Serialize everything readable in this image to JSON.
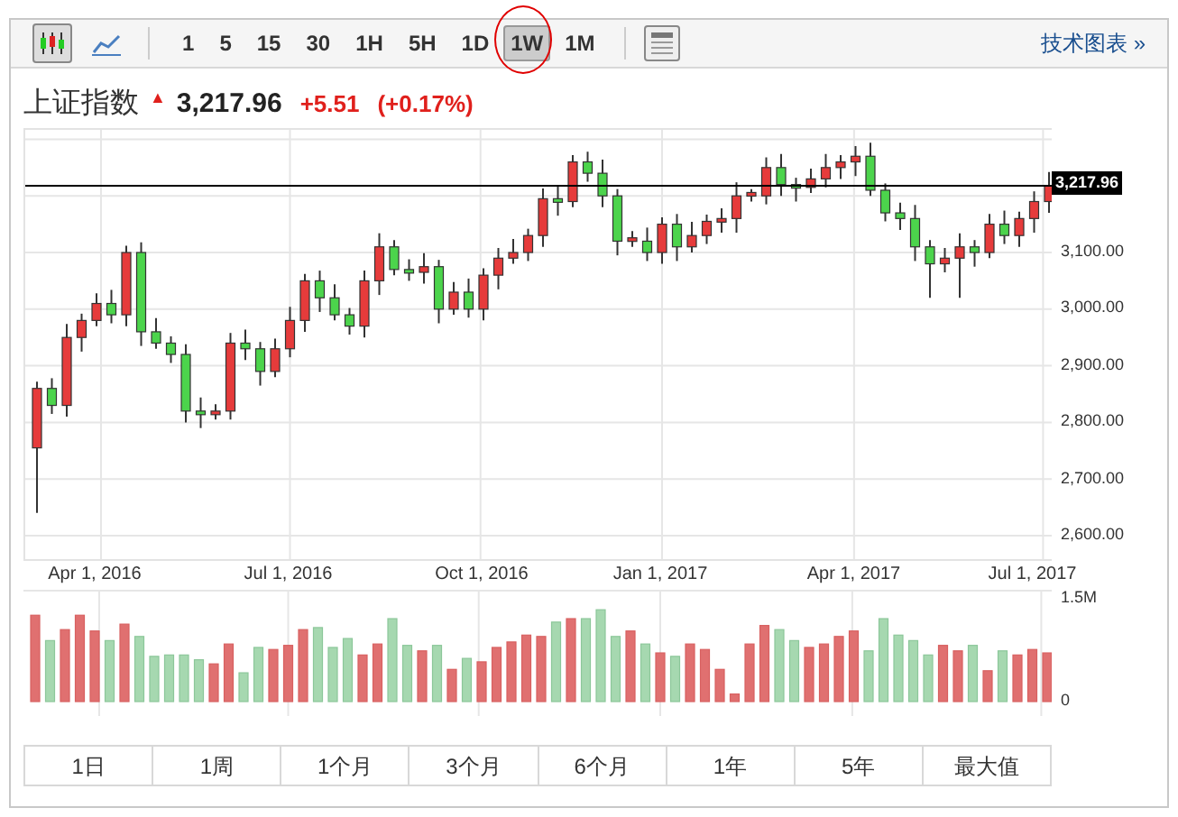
{
  "toolbar": {
    "chart_types": [
      {
        "kind": "candles",
        "selected": true
      },
      {
        "kind": "line",
        "selected": false
      }
    ],
    "intervals": [
      {
        "label": "1",
        "selected": false,
        "circled": false
      },
      {
        "label": "5",
        "selected": false,
        "circled": false
      },
      {
        "label": "15",
        "selected": false,
        "circled": false
      },
      {
        "label": "30",
        "selected": false,
        "circled": false
      },
      {
        "label": "1H",
        "selected": false,
        "circled": false
      },
      {
        "label": "5H",
        "selected": false,
        "circled": false
      },
      {
        "label": "1D",
        "selected": false,
        "circled": false
      },
      {
        "label": "1W",
        "selected": true,
        "circled": true
      },
      {
        "label": "1M",
        "selected": false,
        "circled": false
      }
    ],
    "link": "技术图表 »"
  },
  "quote": {
    "name": "上证指数",
    "arrow": "▲",
    "price": "3,217.96",
    "change": "+5.51",
    "change_percent": "(+0.17%)"
  },
  "price_chart": {
    "chart_data": {
      "type": "candlestick",
      "categories": [
        null,
        null,
        null,
        null,
        "Apr 1, 2016",
        null,
        null,
        null,
        null,
        null,
        null,
        null,
        null,
        null,
        null,
        null,
        null,
        "Jul 1, 2016",
        null,
        null,
        null,
        null,
        null,
        null,
        null,
        null,
        null,
        null,
        null,
        null,
        "Oct 1, 2016",
        null,
        null,
        null,
        null,
        null,
        null,
        null,
        null,
        null,
        null,
        null,
        "Jan 1, 2017",
        null,
        null,
        null,
        null,
        null,
        null,
        null,
        null,
        null,
        null,
        null,
        null,
        "Apr 1, 2017",
        null,
        null,
        null,
        null,
        null,
        null,
        null,
        null,
        null,
        null,
        null,
        "Jul 1, 2017",
        null
      ],
      "ohlc": [
        [
          2755,
          2872,
          2640,
          2860
        ],
        [
          2860,
          2878,
          2815,
          2830
        ],
        [
          2830,
          2974,
          2810,
          2950
        ],
        [
          2950,
          2992,
          2925,
          2980
        ],
        [
          2980,
          3028,
          2970,
          3010
        ],
        [
          3010,
          3034,
          2975,
          2990
        ],
        [
          2990,
          3112,
          2970,
          3100
        ],
        [
          3100,
          3118,
          2935,
          2960
        ],
        [
          2960,
          2984,
          2930,
          2940
        ],
        [
          2940,
          2952,
          2905,
          2920
        ],
        [
          2920,
          2938,
          2800,
          2820
        ],
        [
          2820,
          2844,
          2790,
          2815
        ],
        [
          2815,
          2832,
          2805,
          2820
        ],
        [
          2820,
          2958,
          2805,
          2940
        ],
        [
          2940,
          2964,
          2910,
          2930
        ],
        [
          2930,
          2942,
          2865,
          2890
        ],
        [
          2890,
          2948,
          2880,
          2930
        ],
        [
          2930,
          3004,
          2915,
          2980
        ],
        [
          2980,
          3062,
          2960,
          3050
        ],
        [
          3050,
          3068,
          2995,
          3020
        ],
        [
          3020,
          3044,
          2980,
          2990
        ],
        [
          2990,
          3002,
          2955,
          2970
        ],
        [
          2970,
          3068,
          2950,
          3050
        ],
        [
          3050,
          3134,
          3025,
          3110
        ],
        [
          3110,
          3122,
          3060,
          3070
        ],
        [
          3070,
          3088,
          3050,
          3065
        ],
        [
          3065,
          3099,
          3045,
          3075
        ],
        [
          3075,
          3087,
          2975,
          3000
        ],
        [
          3000,
          3048,
          2990,
          3030
        ],
        [
          3030,
          3054,
          2985,
          3000
        ],
        [
          3000,
          3072,
          2980,
          3060
        ],
        [
          3060,
          3108,
          3035,
          3090
        ],
        [
          3090,
          3124,
          3080,
          3100
        ],
        [
          3100,
          3142,
          3085,
          3130
        ],
        [
          3130,
          3213,
          3110,
          3195
        ],
        [
          3195,
          3219,
          3165,
          3190
        ],
        [
          3190,
          3272,
          3180,
          3260
        ],
        [
          3260,
          3278,
          3225,
          3240
        ],
        [
          3240,
          3264,
          3180,
          3200
        ],
        [
          3200,
          3212,
          3095,
          3120
        ],
        [
          3120,
          3138,
          3110,
          3126
        ],
        [
          3120,
          3144,
          3085,
          3100
        ],
        [
          3100,
          3162,
          3080,
          3150
        ],
        [
          3150,
          3168,
          3085,
          3110
        ],
        [
          3110,
          3154,
          3100,
          3130
        ],
        [
          3130,
          3167,
          3115,
          3155
        ],
        [
          3155,
          3178,
          3135,
          3160
        ],
        [
          3160,
          3224,
          3135,
          3200
        ],
        [
          3200,
          3212,
          3190,
          3206
        ],
        [
          3200,
          3268,
          3185,
          3250
        ],
        [
          3250,
          3274,
          3200,
          3220
        ],
        [
          3220,
          3232,
          3190,
          3215
        ],
        [
          3215,
          3248,
          3205,
          3230
        ],
        [
          3230,
          3274,
          3215,
          3250
        ],
        [
          3250,
          3272,
          3230,
          3260
        ],
        [
          3260,
          3288,
          3235,
          3270
        ],
        [
          3270,
          3294,
          3200,
          3210
        ],
        [
          3210,
          3222,
          3155,
          3170
        ],
        [
          3170,
          3188,
          3140,
          3160
        ],
        [
          3160,
          3184,
          3085,
          3110
        ],
        [
          3110,
          3122,
          3020,
          3080
        ],
        [
          3080,
          3108,
          3065,
          3090
        ],
        [
          3090,
          3134,
          3020,
          3110
        ],
        [
          3110,
          3122,
          3075,
          3100
        ],
        [
          3100,
          3168,
          3090,
          3150
        ],
        [
          3150,
          3174,
          3115,
          3130
        ],
        [
          3130,
          3172,
          3110,
          3160
        ],
        [
          3160,
          3208,
          3135,
          3190
        ],
        [
          3190,
          3242,
          3170,
          3218
        ]
      ],
      "grid": true,
      "ylim": [
        2552.2,
        3316.6
      ],
      "yticks": [
        {
          "value": 3100,
          "label": "3,100.00"
        },
        {
          "value": 3000,
          "label": "3,000.00"
        },
        {
          "value": 2900,
          "label": "2,900.00"
        },
        {
          "value": 2800,
          "label": "2,800.00"
        },
        {
          "value": 2700,
          "label": "2,700.00"
        },
        {
          "value": 2600,
          "label": "2,600.00"
        }
      ],
      "ref_lines": [
        {
          "axis": "y",
          "value": 3217.96,
          "label": "3,217.96"
        }
      ]
    }
  },
  "volume_chart": {
    "chart_data": {
      "type": "bar",
      "grid": true,
      "values": [
        1.26,
        0.89,
        1.05,
        1.26,
        1.03,
        0.89,
        1.13,
        0.95,
        0.66,
        0.68,
        0.68,
        0.61,
        0.55,
        0.84,
        0.42,
        0.79,
        0.76,
        0.82,
        1.05,
        1.08,
        0.79,
        0.92,
        0.68,
        0.84,
        1.21,
        0.82,
        0.74,
        0.82,
        0.47,
        0.63,
        0.58,
        0.79,
        0.87,
        0.97,
        0.95,
        1.16,
        1.21,
        1.21,
        1.34,
        0.95,
        1.03,
        0.84,
        0.71,
        0.66,
        0.84,
        0.76,
        0.47,
        0.11,
        0.84,
        1.11,
        1.05,
        0.89,
        0.79,
        0.84,
        0.95,
        1.03,
        0.74,
        1.21,
        0.97,
        0.89,
        0.68,
        0.82,
        0.74,
        0.82,
        0.45,
        0.74,
        0.68,
        0.76,
        0.71
      ],
      "ylim": [
        0,
        1.5
      ],
      "yticks": [
        {
          "value": 1.5,
          "label": "1.5M"
        },
        {
          "value": 0,
          "label": "0"
        }
      ]
    }
  },
  "ranges": [
    {
      "label": "1日"
    },
    {
      "label": "1周"
    },
    {
      "label": "1个月"
    },
    {
      "label": "3个月"
    },
    {
      "label": "6个月"
    },
    {
      "label": "1年"
    },
    {
      "label": "5年"
    },
    {
      "label": "最大值"
    }
  ]
}
